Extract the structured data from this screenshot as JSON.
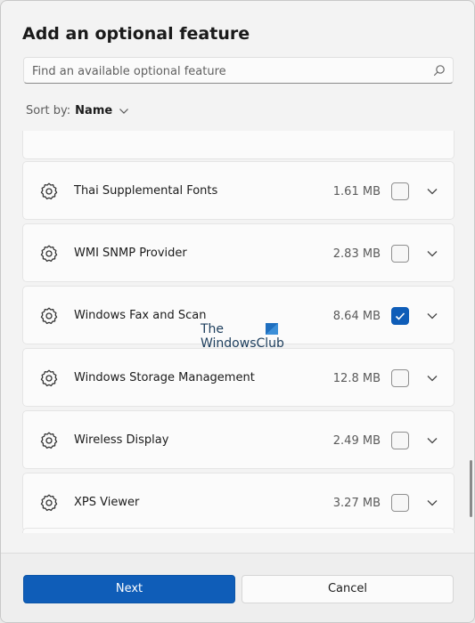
{
  "dialog": {
    "title": "Add an optional feature",
    "search": {
      "placeholder": "Find an available optional feature",
      "value": "",
      "icon": "search-icon"
    },
    "sort": {
      "label": "Sort by:",
      "value": "Name"
    }
  },
  "features": [
    {
      "name": "Thai Supplemental Fonts",
      "size": "1.61 MB",
      "checked": false
    },
    {
      "name": "WMI SNMP Provider",
      "size": "2.83 MB",
      "checked": false
    },
    {
      "name": "Windows Fax and Scan",
      "size": "8.64 MB",
      "checked": true
    },
    {
      "name": "Windows Storage Management",
      "size": "12.8 MB",
      "checked": false
    },
    {
      "name": "Wireless Display",
      "size": "2.49 MB",
      "checked": false
    },
    {
      "name": "XPS Viewer",
      "size": "3.27 MB",
      "checked": false
    }
  ],
  "watermark": {
    "line1": "The",
    "line2": "WindowsClub"
  },
  "footer": {
    "next_label": "Next",
    "cancel_label": "Cancel"
  },
  "colors": {
    "accent": "#0f5db8",
    "background": "#f3f3f3",
    "card": "#fbfbfb"
  }
}
